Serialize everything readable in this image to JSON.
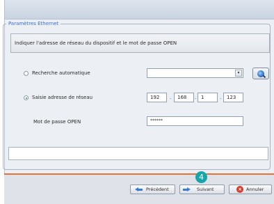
{
  "dialog": {
    "group_title": "Paramètres Ethernet",
    "instruction": "Indiquer l'adresse de réseau du dispositif et le mot de passe OPEN"
  },
  "network": {
    "auto_search_label": "Recherche automatique",
    "auto_search_selected": false,
    "manual_label": "Saisie adresse de réseau",
    "manual_selected": true,
    "combo_value": "",
    "ip": [
      "192",
      "168",
      "1",
      "123"
    ],
    "password_label": "Mot de passe OPEN",
    "password_value": "******"
  },
  "status": {
    "text": ""
  },
  "buttons": {
    "previous": "Précédent",
    "next": "Suivant",
    "cancel": "Annuler"
  },
  "callout": {
    "step": "4",
    "color": "#14a6a9"
  },
  "colors": {
    "legend": "#3b6fd1",
    "footer_accent": "#e5713d"
  }
}
